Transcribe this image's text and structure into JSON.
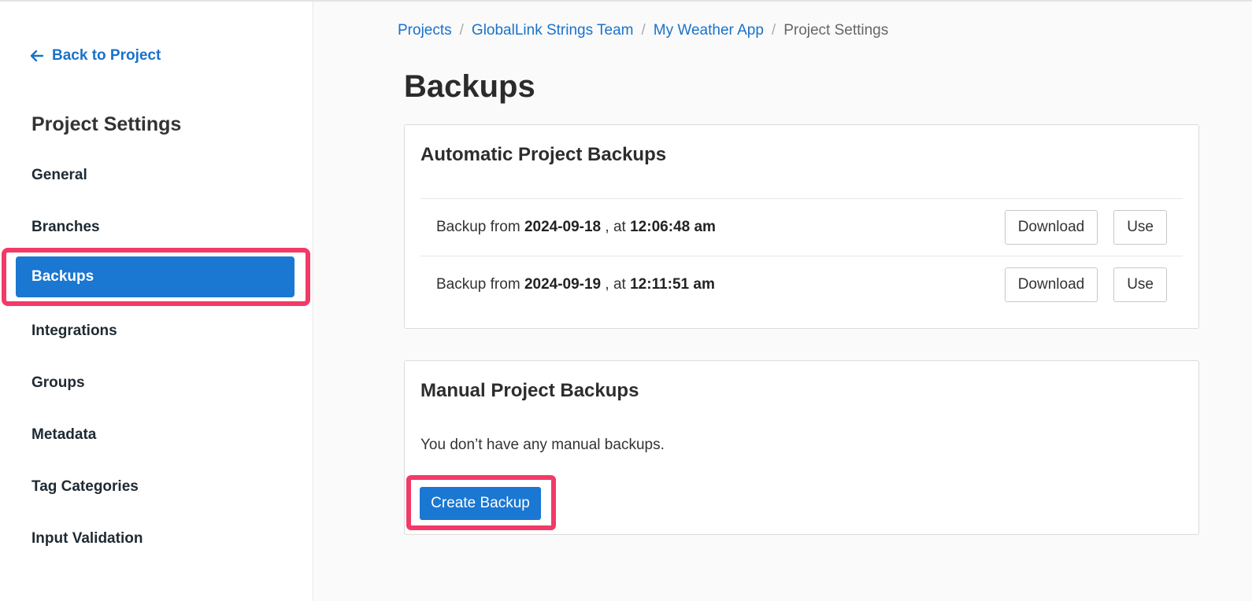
{
  "sidebar": {
    "back_label": "Back to Project",
    "title": "Project Settings",
    "items": [
      {
        "label": "General"
      },
      {
        "label": "Branches"
      },
      {
        "label": "Backups",
        "active": true
      },
      {
        "label": "Integrations"
      },
      {
        "label": "Groups"
      },
      {
        "label": "Metadata"
      },
      {
        "label": "Tag Categories"
      },
      {
        "label": "Input Validation"
      }
    ],
    "accent_color": "#1a77d2",
    "highlight_color": "#f23a68"
  },
  "breadcrumb": {
    "items": [
      "Projects",
      "GlobalLink Strings Team",
      "My Weather App"
    ],
    "current": "Project Settings",
    "separator": "/"
  },
  "page": {
    "title": "Backups"
  },
  "automatic": {
    "title": "Automatic Project Backups",
    "rows": [
      {
        "prefix": "Backup from",
        "date": "2024-09-18",
        "mid": ", at",
        "time": "12:06:48 am",
        "download_label": "Download",
        "use_label": "Use"
      },
      {
        "prefix": "Backup from",
        "date": "2024-09-19",
        "mid": ", at",
        "time": "12:11:51 am",
        "download_label": "Download",
        "use_label": "Use"
      }
    ]
  },
  "manual": {
    "title": "Manual Project Backups",
    "empty_text": "You don’t have any manual backups.",
    "create_label": "Create Backup"
  },
  "icons": {
    "back": "arrow-left-icon"
  }
}
